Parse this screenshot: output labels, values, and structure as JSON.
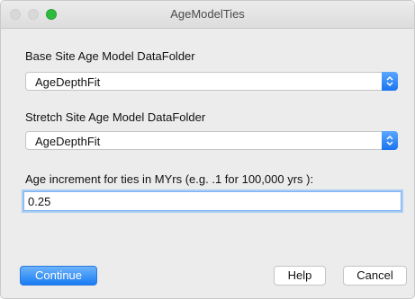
{
  "window": {
    "title": "AgeModelTies"
  },
  "form": {
    "base_label": "Base Site Age Model DataFolder",
    "base_value": "AgeDepthFit",
    "stretch_label": "Stretch Site Age Model DataFolder",
    "stretch_value": "AgeDepthFit",
    "increment_label": "Age increment for ties in MYrs (e.g. .1 for 100,000 yrs ):",
    "increment_value": "0.25"
  },
  "buttons": {
    "continue": "Continue",
    "help": "Help",
    "cancel": "Cancel"
  },
  "colors": {
    "accent": "#1a7cf3",
    "window_bg": "#ececec",
    "zoom_button": "#2dbb3f"
  }
}
